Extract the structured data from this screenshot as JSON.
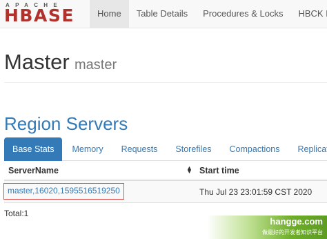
{
  "logo": {
    "top": "APACHE",
    "main": "HBASE"
  },
  "nav": {
    "items": [
      {
        "label": "Home",
        "active": true
      },
      {
        "label": "Table Details"
      },
      {
        "label": "Procedures & Locks"
      },
      {
        "label": "HBCK Report"
      }
    ]
  },
  "header": {
    "title": "Master",
    "subtitle": "master"
  },
  "section": {
    "title": "Region Servers"
  },
  "tabs": [
    {
      "label": "Base Stats",
      "active": true
    },
    {
      "label": "Memory"
    },
    {
      "label": "Requests"
    },
    {
      "label": "Storefiles"
    },
    {
      "label": "Compactions"
    },
    {
      "label": "Replications"
    }
  ],
  "table": {
    "columns": [
      "ServerName",
      "Start time"
    ],
    "sort_icon": "sort-icon",
    "rows": [
      {
        "server": "master,16020,1595516519250",
        "start": "Thu Jul 23 23:01:59 CST 2020"
      }
    ],
    "total": "Total:1"
  },
  "watermark": {
    "main": "hangge.com",
    "sub": "做最好的开发者知识平台"
  },
  "colors": {
    "brand_red": "#b1322c",
    "link_blue": "#337ab7",
    "highlight_border": "#d9534f",
    "watermark_green": "#6fae2a"
  }
}
